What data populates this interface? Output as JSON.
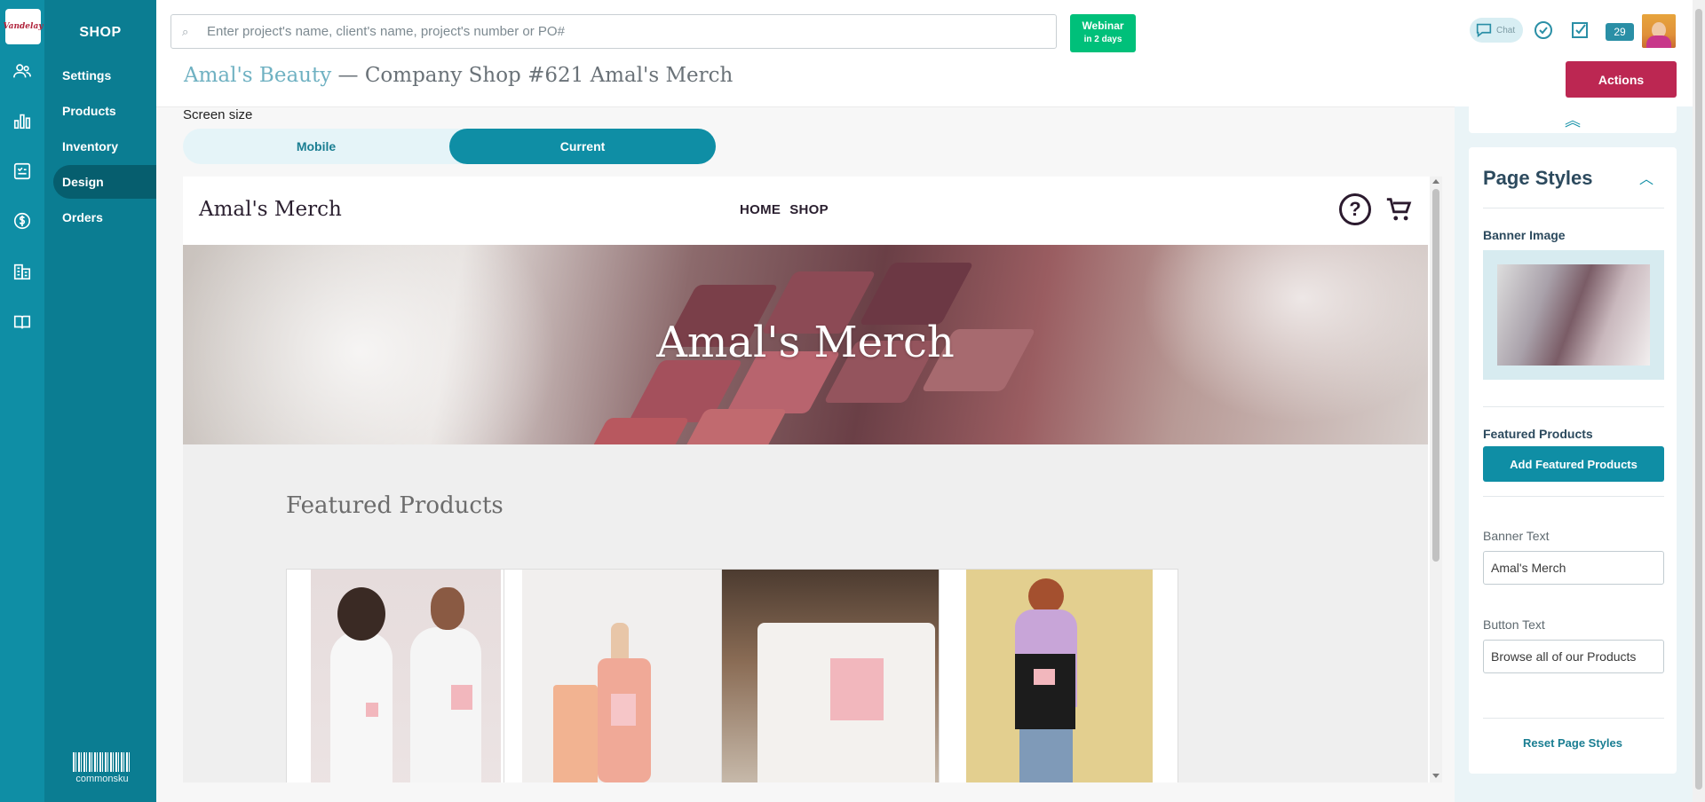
{
  "app": {
    "logo_text": "Vandelay",
    "section_title": "SHOP",
    "footer_brand": "commonsku"
  },
  "rail_icons": [
    "users-icon",
    "bar-chart-icon",
    "checklist-icon",
    "dollar-icon",
    "building-icon",
    "book-icon"
  ],
  "subnav": {
    "items": [
      {
        "label": "Settings"
      },
      {
        "label": "Products"
      },
      {
        "label": "Inventory"
      },
      {
        "label": "Design",
        "active": true
      },
      {
        "label": "Orders"
      }
    ]
  },
  "topbar": {
    "search_placeholder": "Enter project's name, client's name, project's number or PO#",
    "webinar_label": "Webinar",
    "webinar_sub": "in 2 days",
    "chat_label": "Chat",
    "notification_count": "29"
  },
  "header": {
    "client": "Amal's Beauty",
    "separator": " — ",
    "title": "Company Shop #621 Amal's Merch",
    "actions_label": "Actions"
  },
  "preview": {
    "screen_size_label": "Screen size",
    "options": [
      "Mobile",
      "Current"
    ],
    "selected": "Current",
    "shop_brand": "Amal's Merch",
    "nav": [
      "HOME",
      "SHOP"
    ],
    "banner_text": "Amal's Merch",
    "featured_title": "Featured Products",
    "products": [
      "tshirt",
      "skincare",
      "mug",
      "tote"
    ]
  },
  "panel": {
    "title": "Page Styles",
    "banner_image_label": "Banner Image",
    "featured_label": "Featured Products",
    "add_featured_label": "Add Featured Products",
    "banner_text_label": "Banner Text",
    "banner_text_value": "Amal's Merch",
    "button_text_label": "Button Text",
    "button_text_value": "Browse all of our Products",
    "reset_label": "Reset Page Styles"
  },
  "colors": {
    "rail": "#0f8ea5",
    "subnav": "#0b7d92",
    "accent": "#0f8ea5",
    "actions": "#bc2752",
    "webinar": "#00c07a"
  }
}
